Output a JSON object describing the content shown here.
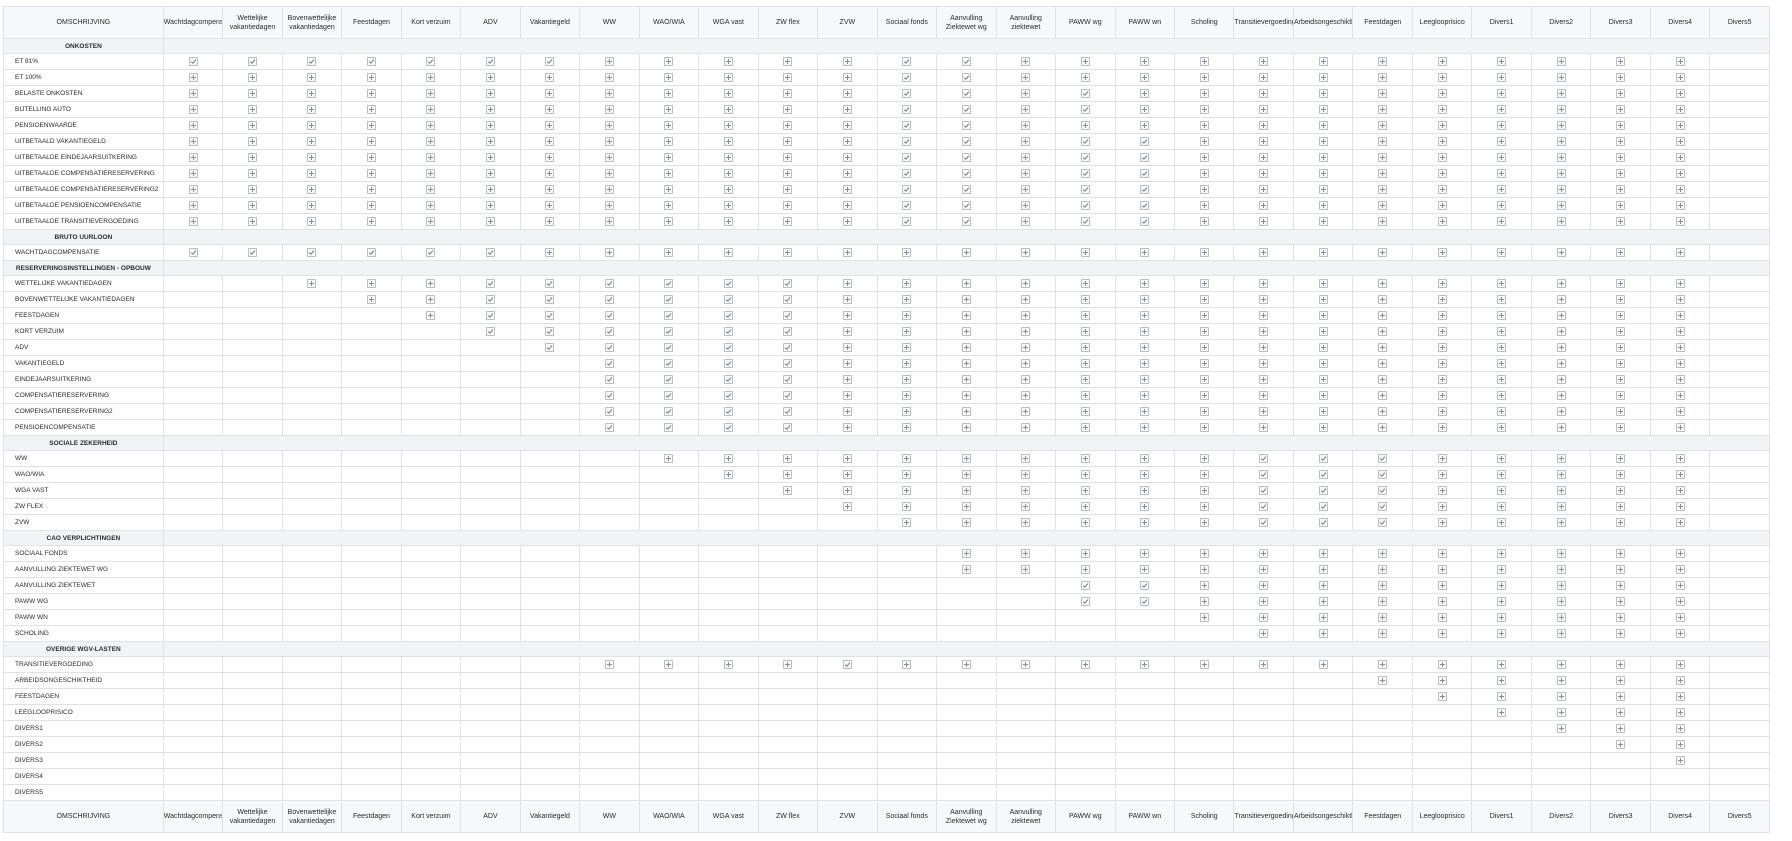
{
  "columns": [
    "OMSCHRIJVING",
    "Wachtdagcompensatie",
    "Wettelijke vakantiedagen",
    "Bovenwettelijke vakantiedagen",
    "Feestdagen",
    "Kort verzuim",
    "ADV",
    "Vakantiegeld",
    "WW",
    "WAO/WIA",
    "WGA vast",
    "ZW flex",
    "ZVW",
    "Sociaal fonds",
    "Aanvulling Ziektewet wg",
    "Aanvulling ziektewet",
    "PAWW wg",
    "PAWW wn",
    "Scholing",
    "Transitievergoeding",
    "Arbeidsongeschiktheid",
    "Feestdagen",
    "Leeglooprisico",
    "Divers1",
    "Divers2",
    "Divers3",
    "Divers4",
    "Divers5"
  ],
  "legend": {
    "check": "check-icon",
    "plus": "plus-icon"
  },
  "rows": [
    {
      "type": "section",
      "label": "ONKOSTEN"
    },
    {
      "label": "ET 81%",
      "cells": "CCCCCCCPPPPPCCPPPPPPPPPPPP"
    },
    {
      "label": "ET 100%",
      "cells": "PPPPPPPPPPPPCCPPPPPPPPPPPP"
    },
    {
      "label": "BELASTE ONKOSTEN",
      "cells": "PPPPPPPPPPPPCCPCPPPPPPPPPP"
    },
    {
      "label": "BIJTELLING AUTO",
      "cells": "PPPPPPPPPPPPCCPCPPPPPPPPPP"
    },
    {
      "label": "PENSIOENWAARDE",
      "cells": "PPPPPPPPPPPPCCPPPPPPPPPPPP"
    },
    {
      "label": "UITBETAALD VAKANTIEGELD",
      "cells": "PPPPPPPPPPPPCCPCCPPPPPPPPP"
    },
    {
      "label": "UITBETAALDE EINDEJAARSUITKERING",
      "cells": "PPPPPPPPPPPPCCPCCPPPPPPPPP"
    },
    {
      "label": "UITBETAALDE COMPENSATIERESERVERING",
      "cells": "PPPPPPPPPPPPCCPCCPPPPPPPPP"
    },
    {
      "label": "UITBETAALDE COMPENSATIERESERVERING2",
      "cells": "PPPPPPPPPPPPCCPCCPPPPPPPPP"
    },
    {
      "label": "UITBETAALDE PENSIOENCOMPENSATIE",
      "cells": "PPPPPPPPPPPPCCPCCPPPPPPPPP"
    },
    {
      "label": "UITBETAALDE TRANSITIEVERGOEDING",
      "cells": "PPPPPPPPPPPPCCPCCPPPPPPPPP"
    },
    {
      "type": "section",
      "label": "BRUTO UURLOON"
    },
    {
      "label": "WACHTDAGCOMPENSATIE",
      "cells": "CCCCCCPPPPPPPPPPPPPPPPPPPP"
    },
    {
      "type": "section",
      "label": "RESERVERINGSINSTELLINGEN - OPBOUW"
    },
    {
      "label": "WETTELIJKE VAKANTIEDAGEN",
      "cells": "__PPPCCCCCCPPPPPPPPPPPPPPP"
    },
    {
      "label": "BOVENWETTELIJKE VAKANTIEDAGEN",
      "cells": "___PPCCCCCCPPPPPPPPPPPPPPP"
    },
    {
      "label": "FEESTDAGEN",
      "cells": "____PCCCCCCPPPPPPPPPPPPPPP"
    },
    {
      "label": "KORT VERZUIM",
      "cells": "_____CCCCCCPPPPPPPPPPPPPPP"
    },
    {
      "label": "ADV",
      "cells": "______CCCCCPPPPPPPPPPPPPPP"
    },
    {
      "label": "VAKANTIEGELD",
      "cells": "_______CCCCPPPPPPPPPPPPPPP"
    },
    {
      "label": "EINDEJAARSUITKERING",
      "cells": "_______CCCCPPPPPPPPPPPPPPP"
    },
    {
      "label": "COMPENSATIERESERVERING",
      "cells": "_______CCCCPPPPPPPPPPPPPPP"
    },
    {
      "label": "COMPENSATIERESERVERING2",
      "cells": "_______CCCCPPPPPPPPPPPPPPP"
    },
    {
      "label": "PENSIOENCOMPENSATIE",
      "cells": "_______CCCCPPPPPPPPPPPPPPP"
    },
    {
      "type": "section",
      "label": "SOCIALE ZEKERHEID"
    },
    {
      "label": "WW",
      "cells": "________PPPPPPPPPPCCCPPPPP"
    },
    {
      "label": "WAO/WIA",
      "cells": "_________PPPPPPPPPCCCPPPPP"
    },
    {
      "label": "WGA VAST",
      "cells": "__________PPPPPPPPCCCPPPPP"
    },
    {
      "label": "ZW FLEX",
      "cells": "___________PPPPPPPCCCPPPPP"
    },
    {
      "label": "ZVW",
      "cells": "____________PPPPPPCCCPPPPP"
    },
    {
      "type": "section",
      "label": "CAO VERPLICHTINGEN"
    },
    {
      "label": "SOCIAAL FONDS",
      "cells": "_____________PPPPPPPPPPPPP"
    },
    {
      "label": "AANVULLING ZIEKTEWET WG",
      "cells": "_____________PPPPPPPPPPPPP"
    },
    {
      "label": "AANVULLING ZIEKTEWET",
      "cells": "_______________CCPPPPPPPPP"
    },
    {
      "label": "PAWW WG",
      "cells": "_______________CCPPPPPPPPP"
    },
    {
      "label": "PAWW WN",
      "cells": "_________________PPPPPPPPP"
    },
    {
      "label": "SCHOLING",
      "cells": "__________________PPPPPPPP"
    },
    {
      "type": "section",
      "label": "OVERIGE WGV-LASTEN"
    },
    {
      "label": "TRANSITIEVERGOEDING",
      "cells": "_______PPPPCPPPPPPPPPPPPPP"
    },
    {
      "label": "ARBEIDSONGESCHIKTHEID",
      "cells": "____________________PPPPPP"
    },
    {
      "label": "FEESTDAGEN",
      "cells": "_____________________PPPPP"
    },
    {
      "label": "LEEGLOOPRISICO",
      "cells": "______________________PPPP"
    },
    {
      "label": "DIVERS1",
      "cells": "_______________________PPP"
    },
    {
      "label": "DIVERS2",
      "cells": "________________________PP"
    },
    {
      "label": "DIVERS3",
      "cells": "_________________________P"
    },
    {
      "label": "DIVERS4",
      "cells": "__________________________"
    },
    {
      "label": "DIVERS5",
      "cells": "__________________________"
    }
  ]
}
